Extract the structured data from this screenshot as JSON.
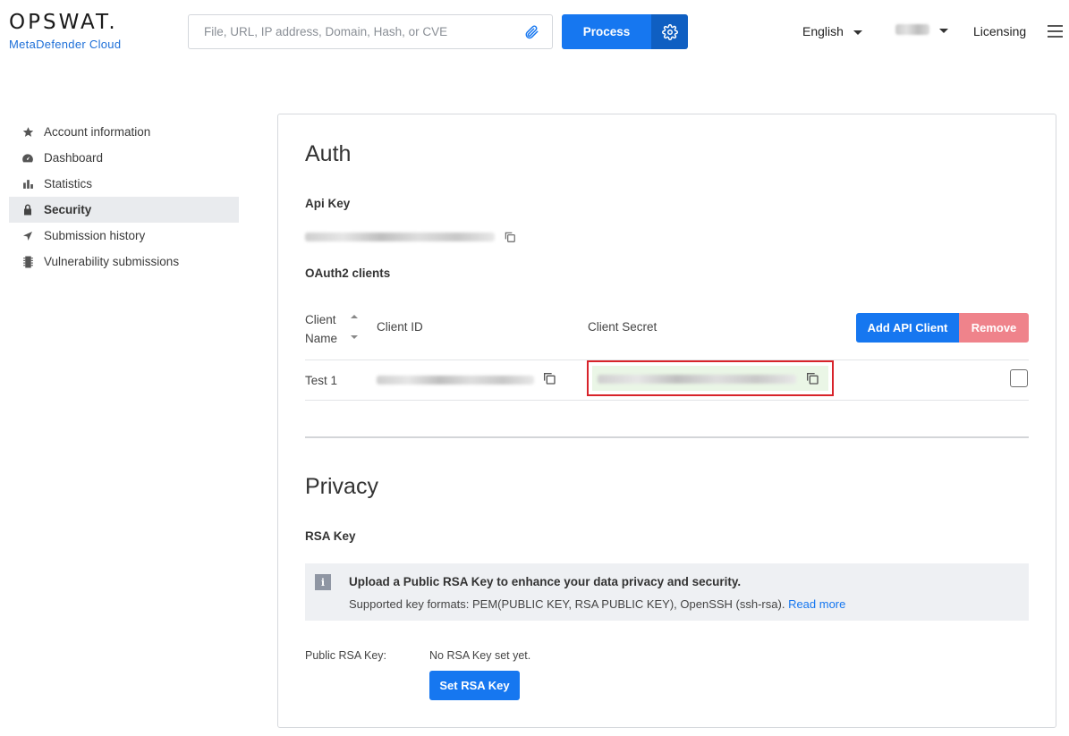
{
  "brand": {
    "logo": "OPSWAT.",
    "product": "MetaDefender Cloud"
  },
  "search": {
    "placeholder": "File, URL, IP address, Domain, Hash, or CVE",
    "value": ""
  },
  "header": {
    "process_label": "Process",
    "language": "English",
    "licensing": "Licensing"
  },
  "sidebar": {
    "items": [
      {
        "label": "Account information",
        "icon": "star-icon"
      },
      {
        "label": "Dashboard",
        "icon": "dashboard-icon"
      },
      {
        "label": "Statistics",
        "icon": "bar-chart-icon"
      },
      {
        "label": "Security",
        "icon": "lock-icon",
        "active": true
      },
      {
        "label": "Submission history",
        "icon": "location-arrow-icon"
      },
      {
        "label": "Vulnerability submissions",
        "icon": "chip-icon"
      }
    ]
  },
  "auth": {
    "title": "Auth",
    "api_key_label": "Api Key",
    "oauth_label": "OAuth2 clients",
    "table": {
      "headers": {
        "name_line1": "Client",
        "name_line2": "Name",
        "client_id": "Client ID",
        "client_secret": "Client Secret"
      },
      "rows": [
        {
          "name": "Test 1"
        }
      ]
    },
    "add_label": "Add API Client",
    "remove_label": "Remove"
  },
  "privacy": {
    "title": "Privacy",
    "rsa_label": "RSA Key",
    "info_title": "Upload a Public RSA Key to enhance your data privacy and security.",
    "info_text": "Supported key formats: PEM(PUBLIC KEY, RSA PUBLIC KEY), OpenSSH (ssh-rsa).",
    "info_link": "Read more",
    "public_key_label": "Public RSA Key:",
    "public_key_value": "No RSA Key set yet.",
    "set_button": "Set RSA Key"
  },
  "colors": {
    "primary": "#1677f0",
    "primary_dark": "#0f5fc2",
    "danger": "#ef838b",
    "highlight": "#d8232a"
  }
}
